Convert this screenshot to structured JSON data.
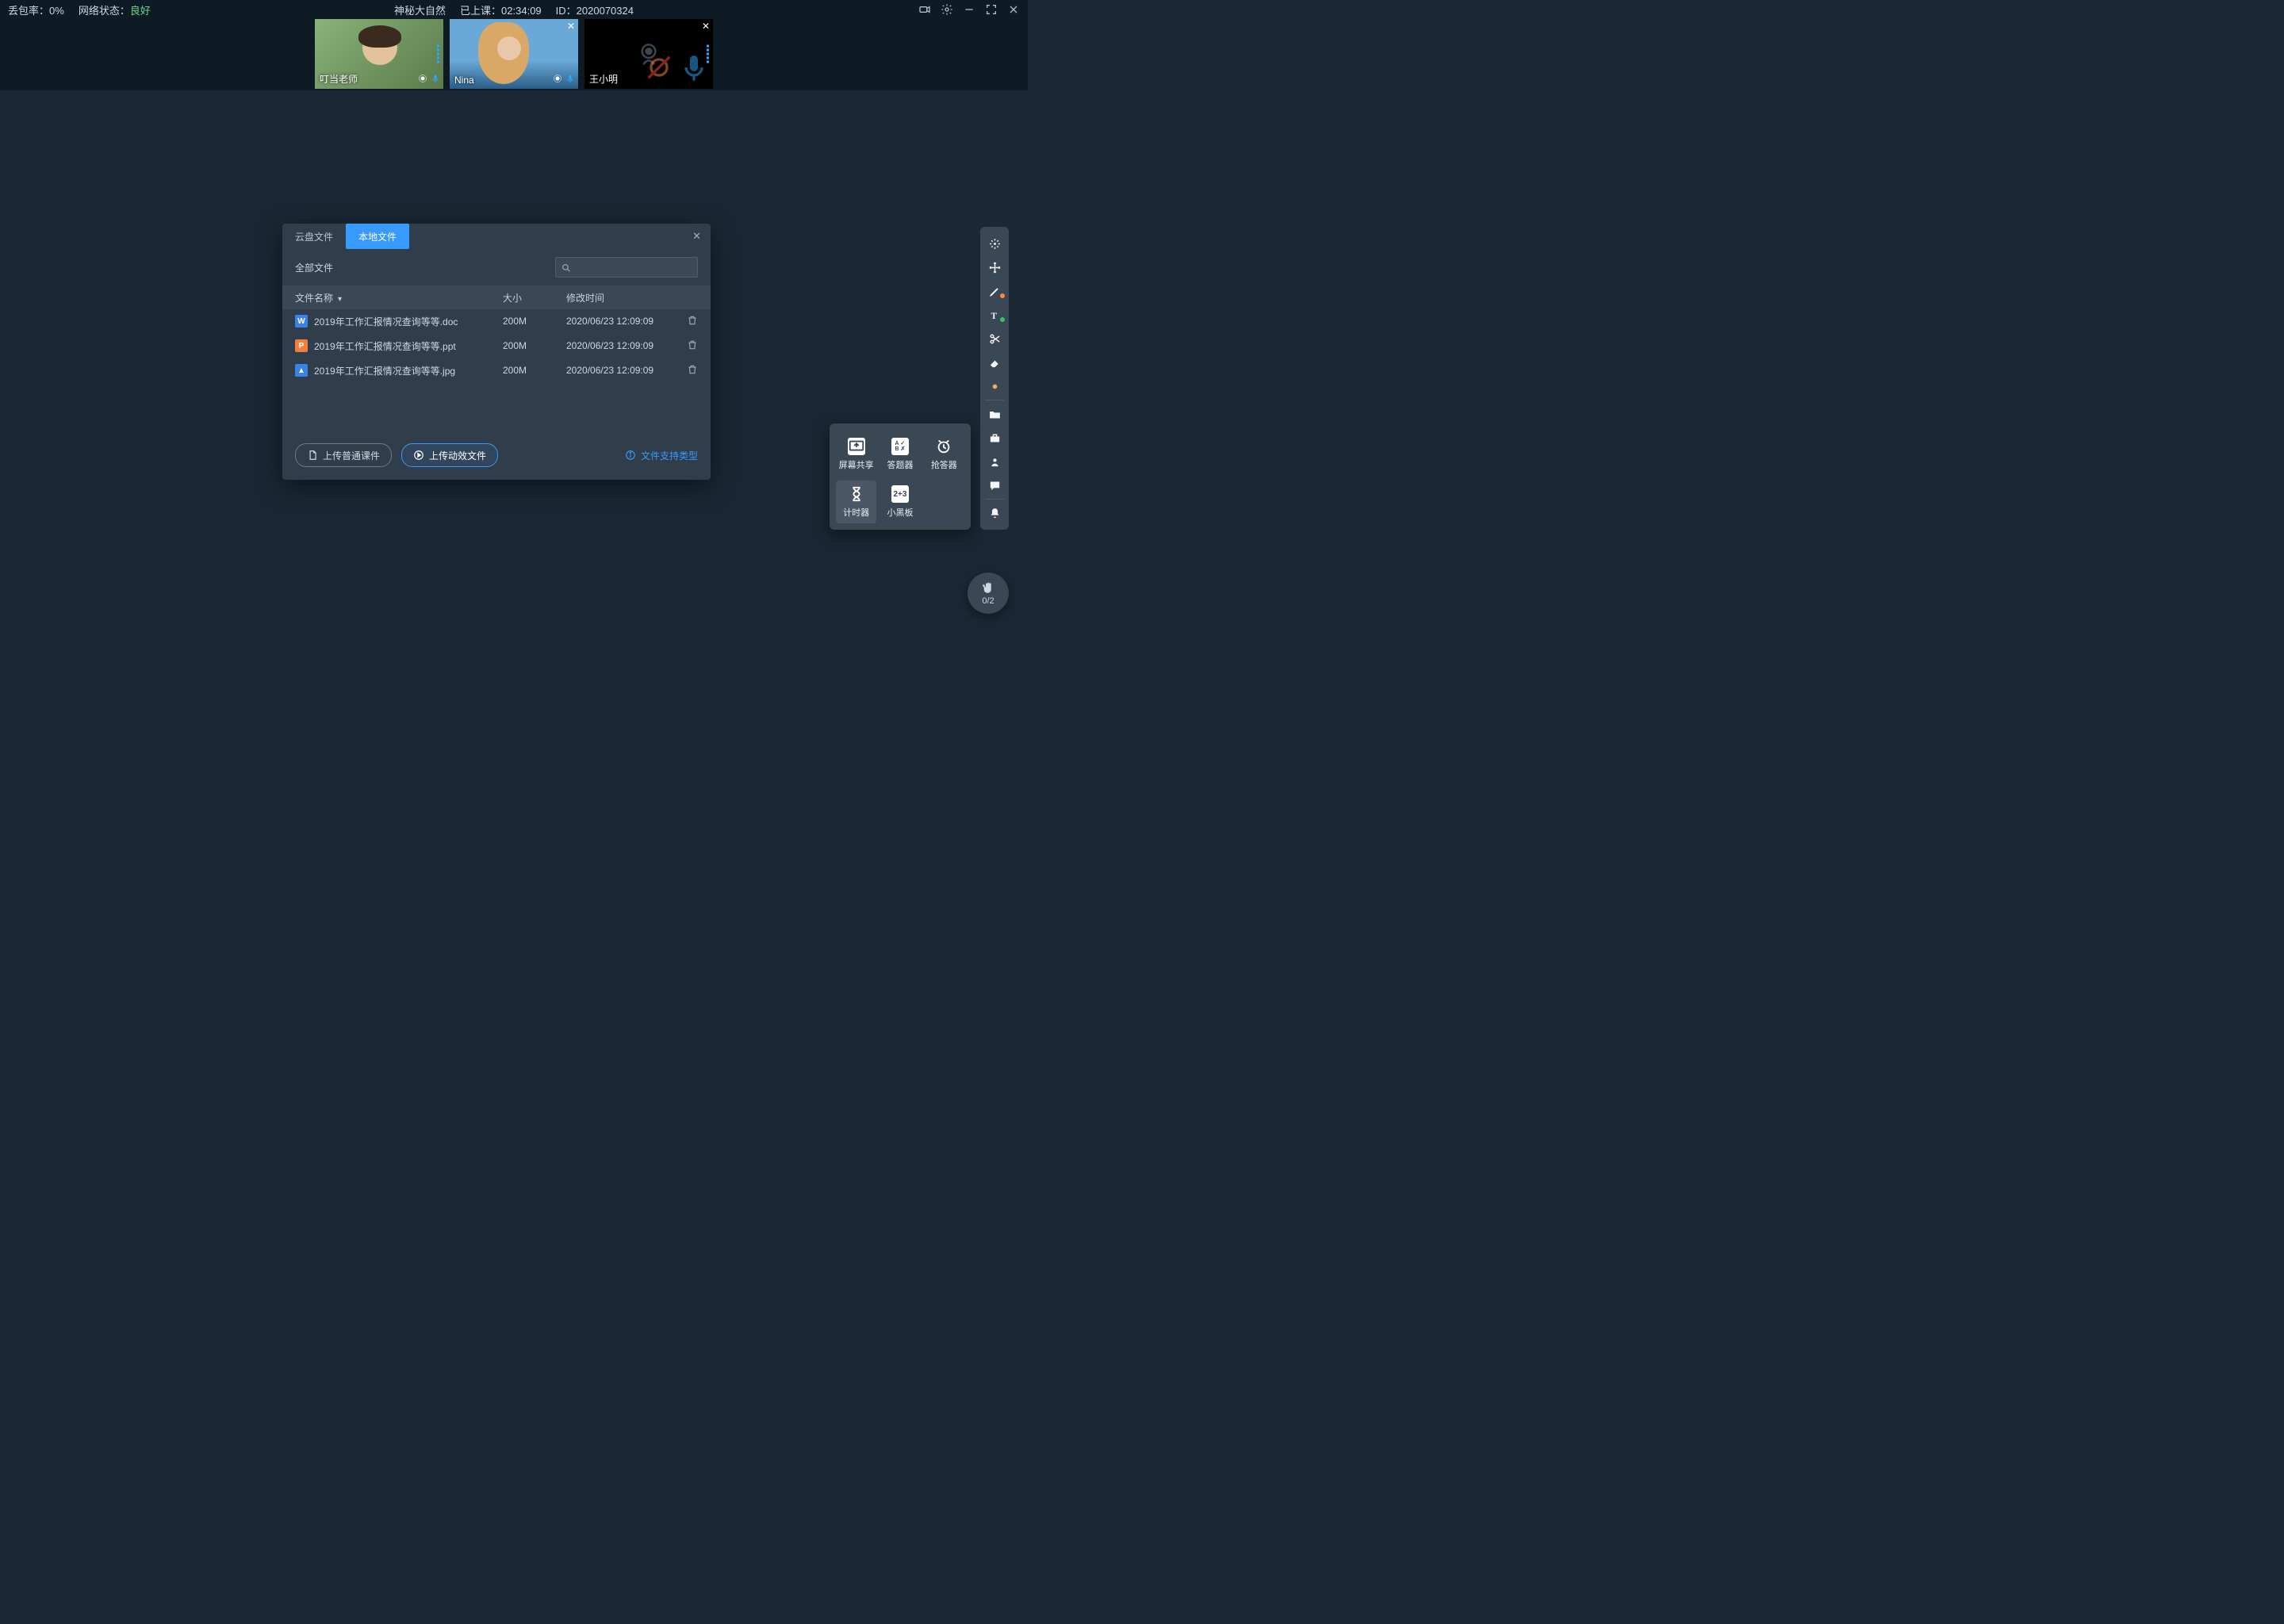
{
  "topbar": {
    "packet_loss_label": "丢包率：",
    "packet_loss_value": "0%",
    "network_label": "网络状态：",
    "network_value": "良好",
    "title": "神秘大自然",
    "elapsed_label": "已上课：",
    "elapsed_value": "02:34:09",
    "id_label": "ID：",
    "id_value": "2020070324"
  },
  "participants": [
    {
      "name": "叮当老师",
      "camera": true,
      "mic_muted": false,
      "closable": false
    },
    {
      "name": "Nina",
      "camera": true,
      "mic_muted": false,
      "closable": true
    },
    {
      "name": "王小明",
      "camera": false,
      "mic_muted": true,
      "closable": true
    }
  ],
  "modal": {
    "tab_cloud": "云盘文件",
    "tab_local": "本地文件",
    "filter_label": "全部文件",
    "col_name": "文件名称",
    "col_size": "大小",
    "col_time": "修改时间",
    "files": [
      {
        "icon": "W",
        "name": "2019年工作汇报情况查询等等.doc",
        "size": "200M",
        "time": "2020/06/23 12:09:09"
      },
      {
        "icon": "P",
        "name": "2019年工作汇报情况查询等等.ppt",
        "size": "200M",
        "time": "2020/06/23 12:09:09"
      },
      {
        "icon": "I",
        "name": "2019年工作汇报情况查询等等.jpg",
        "size": "200M",
        "time": "2020/06/23 12:09:09"
      }
    ],
    "btn_upload": "上传普通课件",
    "btn_upload_fx": "上传动效文件",
    "support_types": "文件支持类型"
  },
  "toolpopup": {
    "share": "屏幕共享",
    "answer": "答题器",
    "buzz": "抢答器",
    "timer": "计时器",
    "board": "小黑板"
  },
  "hand": {
    "count": "0/2"
  }
}
